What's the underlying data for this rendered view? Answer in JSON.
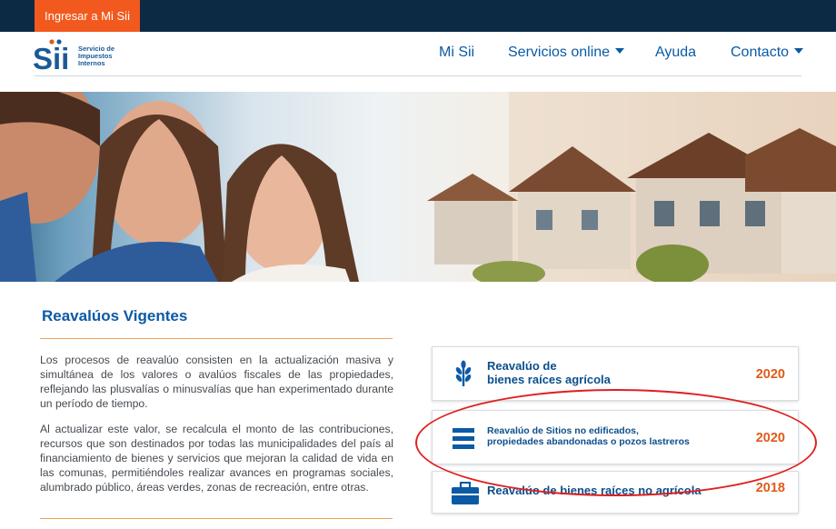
{
  "topbar": {
    "login_label": "Ingresar a Mi Sii"
  },
  "header": {
    "logo_mark": "Sii",
    "logo_text": "Servicio de\nImpuestos\nInternos",
    "nav": [
      {
        "label": "Mi Sii",
        "has_caret": false
      },
      {
        "label": "Servicios online",
        "has_caret": true
      },
      {
        "label": "Ayuda",
        "has_caret": false
      },
      {
        "label": "Contacto",
        "has_caret": true
      }
    ]
  },
  "main": {
    "title": "Reavalúos Vigentes",
    "paragraphs": [
      "Los procesos de reavalúo consisten en la actualización masiva y simultánea de los valores o avalúos fiscales de las propiedades, reflejando las plusvalías o minusvalías que han experimentado durante un período de tiempo.",
      "Al actualizar este valor, se recalcula el monto de las contribuciones, recursos que son destinados por todas las municipalidades del país al financiamiento de bienes y servicios que mejoran la calidad de vida en las comunas, permitiéndoles realizar avances en programas sociales, alumbrado público, áreas verdes, zonas de recreación, entre otras."
    ]
  },
  "cards": [
    {
      "label": "Reavalúo de\nbienes raíces agrícola",
      "year": "2020",
      "icon": "wheat-icon"
    },
    {
      "label": "Reavalúo de Sitios no edificados,\npropiedades abandonadas o pozos lastreros",
      "year": "2020",
      "icon": "list-icon"
    },
    {
      "label": "Reavalúo de bienes raíces no agrícola",
      "year": "2018",
      "icon": "briefcase-icon"
    }
  ],
  "colors": {
    "accent": "#f2591e",
    "brand_blue": "#0b5aa5",
    "topbar": "#0c2a44",
    "year": "#e05a17",
    "highlight": "#e0201f"
  }
}
